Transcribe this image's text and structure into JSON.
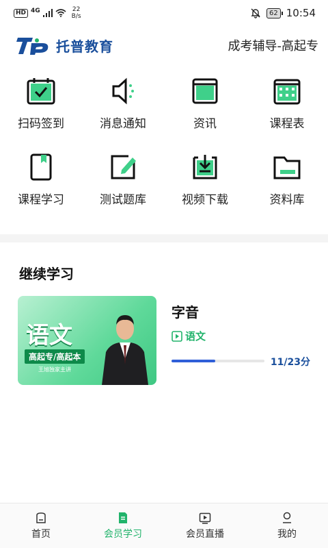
{
  "status_bar": {
    "hd": "HD",
    "network": "4G",
    "speed_value": "22",
    "speed_unit": "B/s",
    "battery": "62",
    "time": "10:54"
  },
  "header": {
    "brand": "托普教育",
    "title": "成考辅导-高起专"
  },
  "grid": [
    {
      "label": "扫码签到",
      "icon": "calendar-check-icon"
    },
    {
      "label": "消息通知",
      "icon": "speaker-icon"
    },
    {
      "label": "资讯",
      "icon": "window-icon"
    },
    {
      "label": "课程表",
      "icon": "calendar-grid-icon"
    },
    {
      "label": "课程学习",
      "icon": "book-icon"
    },
    {
      "label": "测试题库",
      "icon": "edit-icon"
    },
    {
      "label": "视频下载",
      "icon": "download-icon"
    },
    {
      "label": "资料库",
      "icon": "folder-icon"
    }
  ],
  "continue": {
    "title": "继续学习",
    "course": {
      "thumb_title": "语文",
      "thumb_sub": "高起专/高起本",
      "thumb_teacher": "王旭独家主讲",
      "name": "字音",
      "subject": "语文",
      "progress": 0.47,
      "progress_text": "11/23分"
    }
  },
  "tabs": [
    {
      "label": "首页",
      "icon": "home-icon",
      "active": false
    },
    {
      "label": "会员学习",
      "icon": "document-icon",
      "active": true
    },
    {
      "label": "会员直播",
      "icon": "play-icon",
      "active": false
    },
    {
      "label": "我的",
      "icon": "user-icon",
      "active": false
    }
  ],
  "colors": {
    "accent_green": "#21b36b",
    "brand_blue": "#1a4f9c",
    "progress_blue": "#2f5fd8"
  }
}
